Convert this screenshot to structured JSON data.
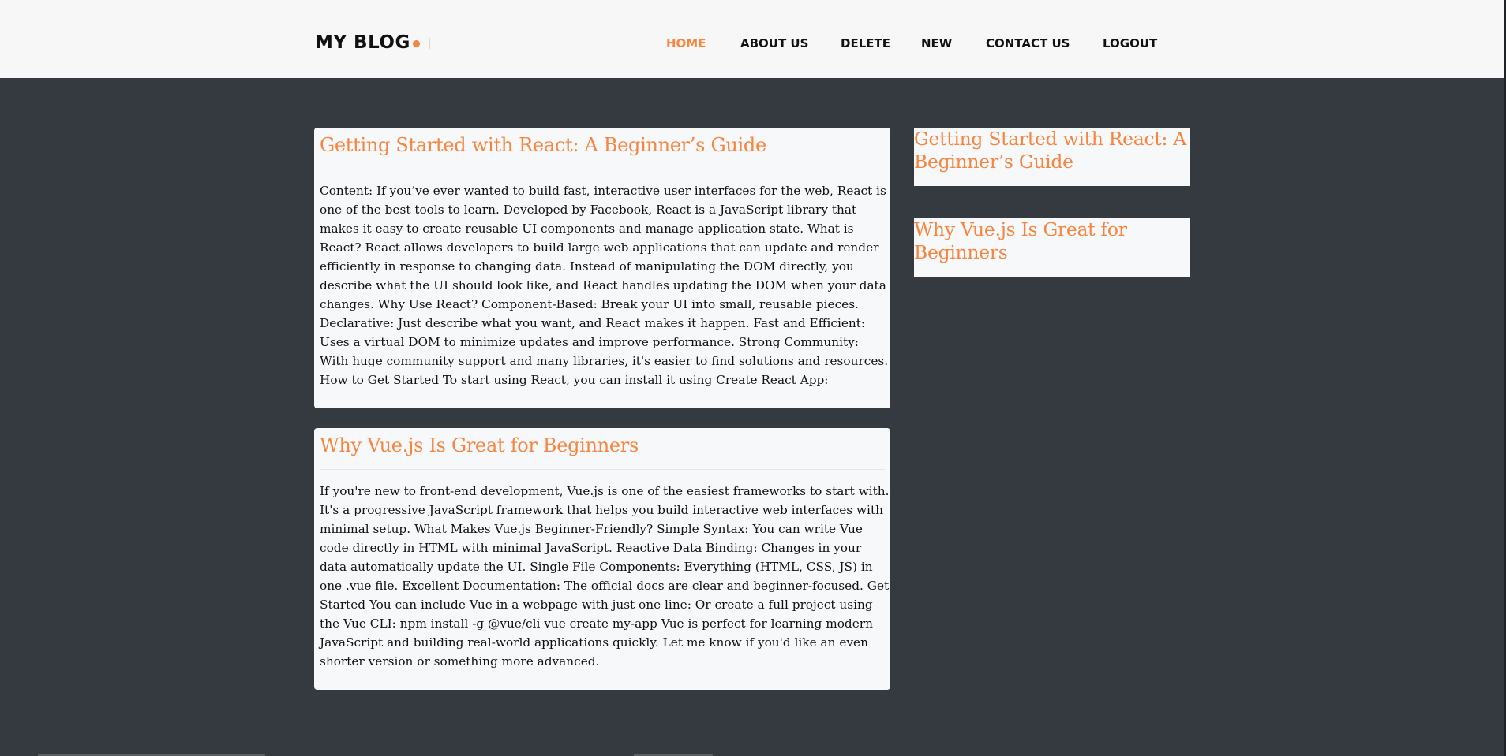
{
  "brand": {
    "name": "MY BLOG"
  },
  "nav": {
    "items": [
      {
        "label": "HOME",
        "active": true
      },
      {
        "label": "ABOUT US",
        "active": false
      },
      {
        "label": "DELETE",
        "active": false
      },
      {
        "label": "NEW",
        "active": false
      },
      {
        "label": "CONTACT US",
        "active": false
      },
      {
        "label": "LOGOUT",
        "active": false
      }
    ]
  },
  "posts": [
    {
      "title": "Getting Started with React: A Beginner’s Guide",
      "content": "Content: If you’ve ever wanted to build fast, interactive user interfaces for the web, React is one of the best tools to learn. Developed by Facebook, React is a JavaScript library that makes it easy to create reusable UI components and manage application state. What is React? React allows developers to build large web applications that can update and render efficiently in response to changing data. Instead of manipulating the DOM directly, you describe what the UI should look like, and React handles updating the DOM when your data changes. Why Use React? Component-Based: Break your UI into small, reusable pieces. Declarative: Just describe what you want, and React makes it happen. Fast and Efficient: Uses a virtual DOM to minimize updates and improve performance. Strong Community: With huge community support and many libraries, it's easier to find solutions and resources. How to Get Started To start using React, you can install it using Create React App:"
    },
    {
      "title": "Why Vue.js Is Great for Beginners",
      "content": "If you're new to front-end development, Vue.js is one of the easiest frameworks to start with. It's a progressive JavaScript framework that helps you build interactive web interfaces with minimal setup. What Makes Vue.js Beginner-Friendly? Simple Syntax: You can write Vue code directly in HTML with minimal JavaScript. Reactive Data Binding: Changes in your data automatically update the UI. Single File Components: Everything (HTML, CSS, JS) in one .vue file. Excellent Documentation: The official docs are clear and beginner-focused. Get Started You can include Vue in a webpage with just one line: Or create a full project using the Vue CLI: npm install -g @vue/cli vue create my-app Vue is perfect for learning modern JavaScript and building real-world applications quickly. Let me know if you'd like an even shorter version or something more advanced."
    }
  ],
  "sidebar": {
    "items": [
      {
        "title": "Getting Started with React: A Beginner’s Guide"
      },
      {
        "title": "Why Vue.js Is Great for Beginners"
      }
    ]
  },
  "colors": {
    "accent": "#f5853f",
    "page_background": "#343a40",
    "header_background": "#f7f7f7",
    "card_background": "#f7f8fa",
    "text": "#111111"
  }
}
